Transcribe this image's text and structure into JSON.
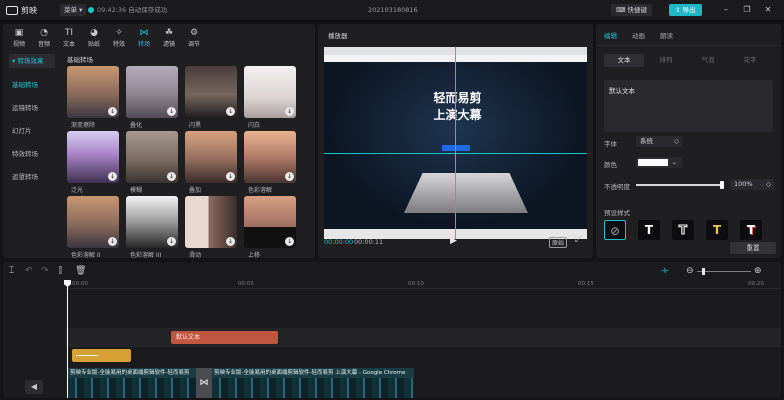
{
  "titlebar": {
    "app_name": "剪映",
    "menu_label": "菜单",
    "autosave": "09:42:36 自动保存成功",
    "project_name": "202103180816",
    "shortcut_label": "快捷键",
    "export_label": "导出"
  },
  "toolbar": {
    "items": [
      {
        "label": "视频",
        "icon": "video-icon"
      },
      {
        "label": "音频",
        "icon": "audio-icon"
      },
      {
        "label": "文本",
        "icon": "text-icon"
      },
      {
        "label": "贴纸",
        "icon": "sticker-icon"
      },
      {
        "label": "特效",
        "icon": "effects-icon"
      },
      {
        "label": "转场",
        "icon": "transition-icon"
      },
      {
        "label": "滤镜",
        "icon": "filter-icon"
      },
      {
        "label": "调节",
        "icon": "adjust-icon"
      }
    ],
    "active": "转场"
  },
  "sidebar": {
    "items": [
      {
        "label": "转场效果"
      },
      {
        "label": "基础转场"
      },
      {
        "label": "运镜转场"
      },
      {
        "label": "幻灯片"
      },
      {
        "label": "特效转场"
      },
      {
        "label": "遮罩转场"
      }
    ]
  },
  "grid": {
    "title": "基础转场",
    "thumbs": [
      {
        "label": "渐变擦除"
      },
      {
        "label": "叠化"
      },
      {
        "label": "闪黑"
      },
      {
        "label": "闪白"
      },
      {
        "label": "泛光"
      },
      {
        "label": "模糊"
      },
      {
        "label": "叠加"
      },
      {
        "label": "色彩溶解"
      },
      {
        "label": "色彩溶解 II"
      },
      {
        "label": "色彩溶解 III"
      },
      {
        "label": "滑动"
      },
      {
        "label": "上移"
      }
    ]
  },
  "player": {
    "title": "播放器",
    "headline_line1": "轻而易剪",
    "headline_line2": "上演大幕",
    "current_time": "00:00:00",
    "total_time": "00:00:11",
    "ratio_label": "原始"
  },
  "inspector": {
    "tabs": [
      "编辑",
      "动画",
      "朗读"
    ],
    "subtabs": [
      "文本",
      "排列",
      "气泡",
      "花字"
    ],
    "text_value": "默认文本",
    "font_label": "字体",
    "font_value": "系统",
    "color_label": "颜色",
    "opacity_label": "不透明度",
    "opacity_value": "100%",
    "opacity": 1.0,
    "preset_label": "预设样式",
    "preset_glyph": "T",
    "reset_label": "重置"
  },
  "timeline": {
    "ticks": [
      "00:00",
      "00:05",
      "00:10",
      "00:15",
      "00:20"
    ],
    "text_clip_label": "默认文本",
    "video_clip_title_a": "剪映专业版-全能易用的桌面端剪辑软件-轻而易剪",
    "video_clip_title_b": "剪映专业版-全能易用的桌面端剪辑软件-轻而易剪 上演大幕 - Google Chrome"
  },
  "colors": {
    "accent": "#1fb7c7",
    "text_clip": "#c0563f",
    "sticker_clip": "#d7a035"
  }
}
